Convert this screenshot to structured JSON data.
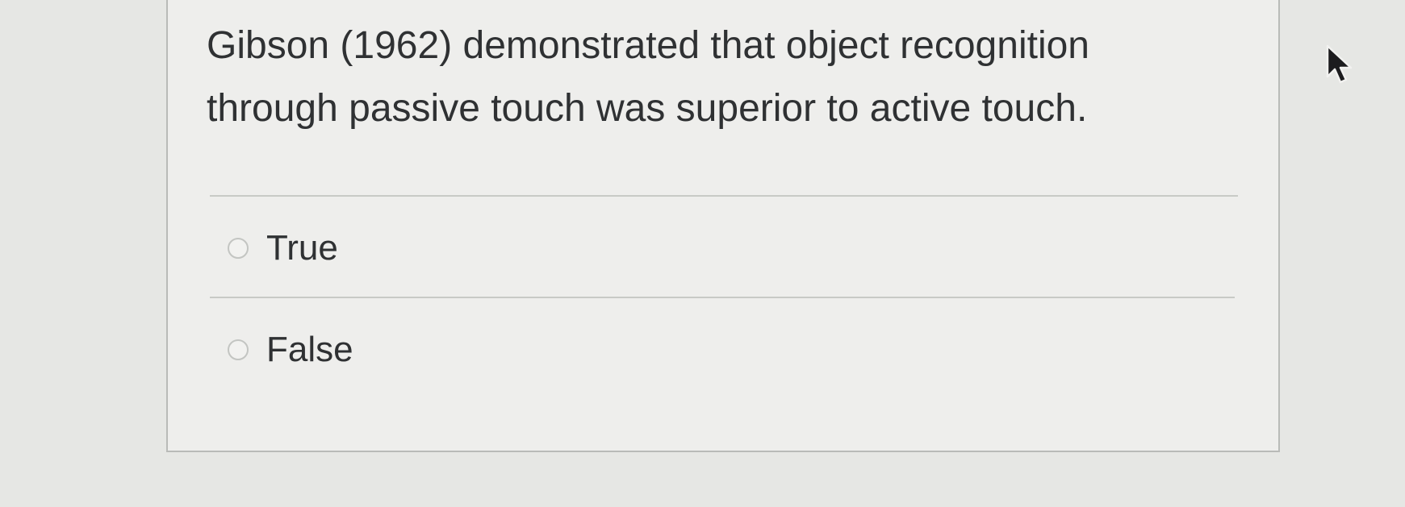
{
  "question": {
    "text_line1": "Gibson (1962) demonstrated that object recognition",
    "text_line2": "through passive touch was superior to active touch."
  },
  "options": [
    {
      "label": "True",
      "selected": false
    },
    {
      "label": "False",
      "selected": false
    }
  ],
  "icons": {
    "cursor": "mouse-pointer-icon",
    "radio": "radio-button-icon"
  },
  "colors": {
    "background": "#e6e7e4",
    "card": "#eeeeec",
    "text": "#2f3133",
    "border": "#b9bbb8"
  }
}
